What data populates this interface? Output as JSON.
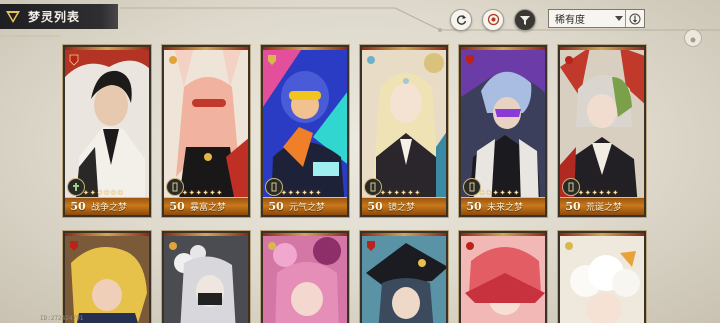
{
  "header": {
    "title": "梦灵列表",
    "sort_label": "稀有度"
  },
  "cards_row1": [
    {
      "level": "50",
      "name": "战争之梦",
      "stars": "✦✦✦✦✦✦"
    },
    {
      "level": "50",
      "name": "暴富之梦",
      "stars": "✦✦✦✦✦✦"
    },
    {
      "level": "50",
      "name": "元气之梦",
      "stars": "✦✦✦✦✦✦"
    },
    {
      "level": "50",
      "name": "镜之梦",
      "stars": "✦✦✦✦✦✦"
    },
    {
      "level": "50",
      "name": "未来之梦",
      "stars": "✦✦✦✦✦✦"
    },
    {
      "level": "50",
      "name": "荒诞之梦",
      "stars": "✦✦✦✦✦✦"
    }
  ],
  "footer": {
    "uid": "ID:272424791"
  }
}
